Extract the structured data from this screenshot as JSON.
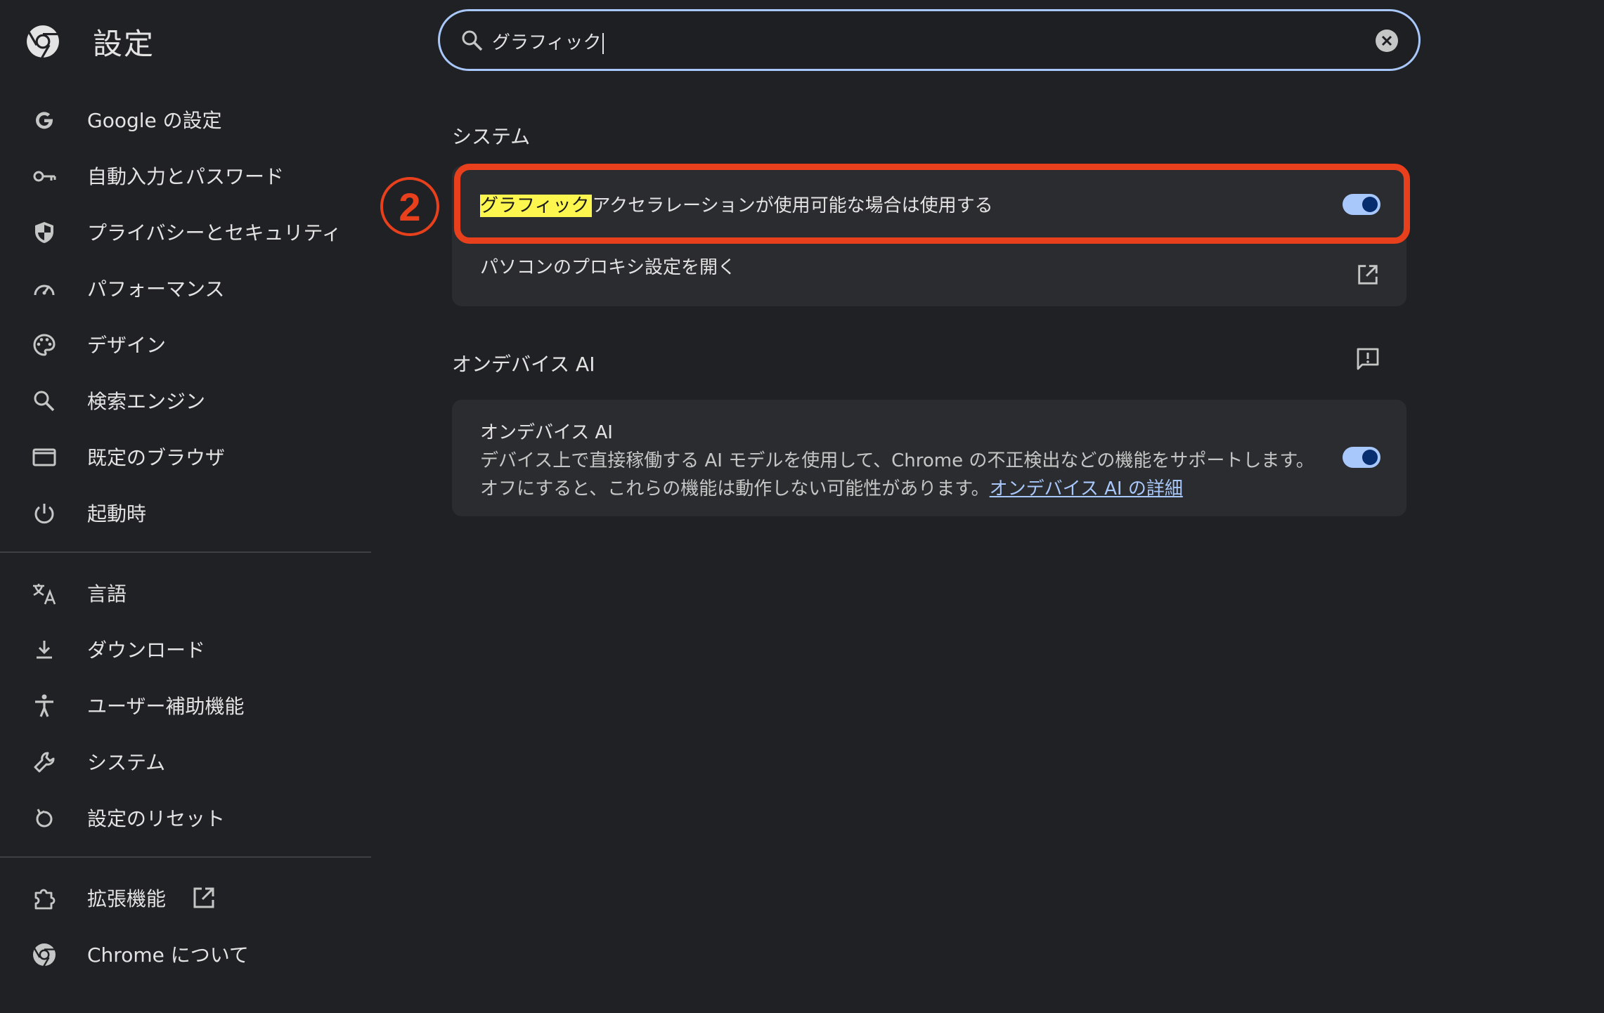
{
  "app": {
    "title": "設定",
    "brand_icon": "chrome-logo-icon"
  },
  "search": {
    "value": "グラフィック",
    "icon": "search-icon",
    "clear_icon": "clear-circle-icon"
  },
  "sidebar": {
    "items": [
      {
        "label": "Google の設定",
        "icon": "google-g-icon"
      },
      {
        "label": "自動入力とパスワード",
        "icon": "key-icon"
      },
      {
        "label": "プライバシーとセキュリティ",
        "icon": "shield-icon"
      },
      {
        "label": "パフォーマンス",
        "icon": "speedometer-icon"
      },
      {
        "label": "デザイン",
        "icon": "palette-icon"
      },
      {
        "label": "検索エンジン",
        "icon": "search-icon"
      },
      {
        "label": "既定のブラウザ",
        "icon": "browser-window-icon"
      },
      {
        "label": "起動時",
        "icon": "power-icon"
      },
      {
        "label": "言語",
        "icon": "translate-icon"
      },
      {
        "label": "ダウンロード",
        "icon": "download-icon"
      },
      {
        "label": "ユーザー補助機能",
        "icon": "accessibility-icon"
      },
      {
        "label": "システム",
        "icon": "wrench-icon"
      },
      {
        "label": "設定のリセット",
        "icon": "reset-icon"
      },
      {
        "label": "拡張機能",
        "icon": "puzzle-icon",
        "external_icon": "open-in-new-icon"
      },
      {
        "label": "Chrome について",
        "icon": "chrome-logo-icon"
      }
    ]
  },
  "sections": {
    "system": {
      "title": "システム",
      "hw_accel": {
        "highlight": "グラフィック",
        "rest": "アクセラレーションが使用可能な場合は使用する",
        "enabled": true
      },
      "proxy": {
        "label": "パソコンのプロキシ設定を開く",
        "icon": "open-in-new-icon"
      }
    },
    "ondevice_ai": {
      "title": "オンデバイス AI",
      "feedback_icon": "feedback-icon",
      "row_title": "オンデバイス AI",
      "desc_line1": "デバイス上で直接稼働する AI モデルを使用して、Chrome の不正検出などの機能をサポートします。",
      "desc_line2": "オフにすると、これらの機能は動作しない可能性があります。",
      "link_text": "オンデバイス AI の詳細",
      "enabled": true
    }
  },
  "annotation": {
    "step_number": "2",
    "color": "#e8401c"
  },
  "colors": {
    "background": "#202124",
    "card": "#2b2c2f",
    "accent": "#a8c7fa",
    "text": "#e3e3e3"
  }
}
